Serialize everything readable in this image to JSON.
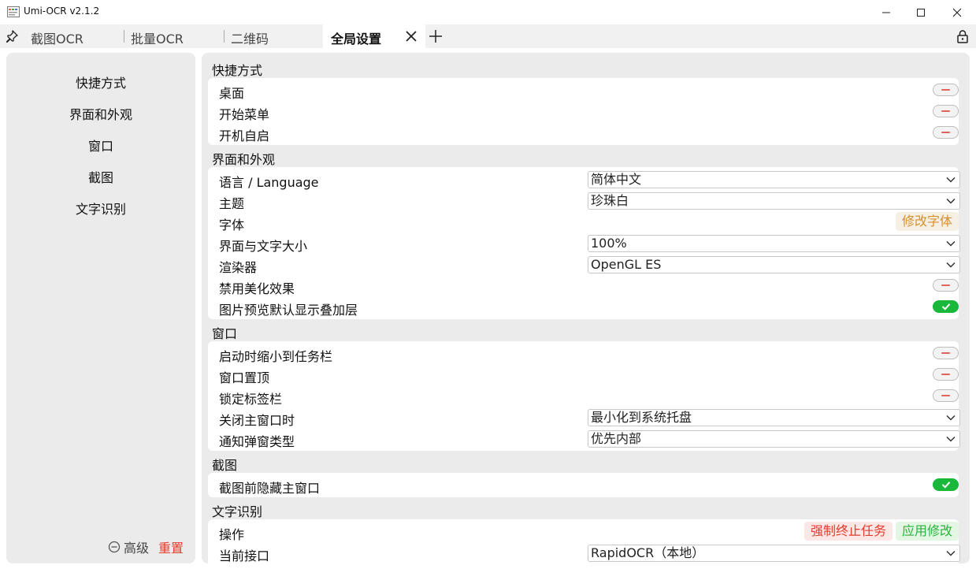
{
  "window": {
    "title": "Umi-OCR v2.1.2"
  },
  "tabs": [
    {
      "label": "截图OCR"
    },
    {
      "label": "批量OCR"
    },
    {
      "label": "二维码"
    },
    {
      "label": "全局设置",
      "active": true
    }
  ],
  "sidebar": {
    "items": [
      "快捷方式",
      "界面和外观",
      "窗口",
      "截图",
      "文字识别"
    ],
    "advanced_label": "高级",
    "reset_label": "重置"
  },
  "groups": {
    "shortcuts": {
      "title": "快捷方式",
      "desktop": "桌面",
      "start_menu": "开始菜单",
      "autostart": "开机自启"
    },
    "ui": {
      "title": "界面和外观",
      "language_label": "语言 / Language",
      "language_value": "简体中文",
      "theme_label": "主题",
      "theme_value": "珍珠白",
      "font_label": "字体",
      "font_button": "修改字体",
      "scale_label": "界面与文字大小",
      "scale_value": "100%",
      "renderer_label": "渲染器",
      "renderer_value": "OpenGL ES",
      "disable_effects_label": "禁用美化效果",
      "preview_overlay_label": "图片预览默认显示叠加层"
    },
    "window": {
      "title": "窗口",
      "minimize_on_start": "启动时缩小到任务栏",
      "always_on_top": "窗口置顶",
      "lock_tabbar": "锁定标签栏",
      "on_close_label": "关闭主窗口时",
      "on_close_value": "最小化到系统托盘",
      "notify_type_label": "通知弹窗类型",
      "notify_type_value": "优先内部"
    },
    "screenshot": {
      "title": "截图",
      "hide_main_window": "截图前隐藏主窗口"
    },
    "ocr": {
      "title": "文字识别",
      "operation_label": "操作",
      "force_stop_button": "强制终止任务",
      "apply_button": "应用修改",
      "current_api_label": "当前接口",
      "current_api_value": "RapidOCR（本地）"
    }
  },
  "toggles": {
    "desktop": false,
    "start_menu": false,
    "autostart": false,
    "disable_effects": false,
    "preview_overlay": true,
    "minimize_on_start": false,
    "always_on_top": false,
    "lock_tabbar": false,
    "hide_main_window": true
  },
  "colors": {
    "accent_green": "#19b83a",
    "danger_red": "#e43b2e",
    "font_button_orange": "#d6902e",
    "panel_bg": "#ebebeb"
  }
}
